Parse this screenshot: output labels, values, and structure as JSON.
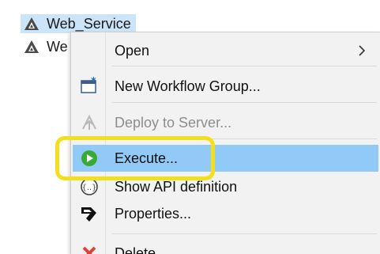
{
  "tree": {
    "items": [
      {
        "label": "Web_Service",
        "selected": true,
        "icon": "service-triangle-icon"
      },
      {
        "label": "We",
        "selected": false,
        "icon": "service-triangle-icon"
      }
    ]
  },
  "context_menu": {
    "items": [
      {
        "id": "open",
        "label": "Open",
        "has_submenu": true,
        "icon": ""
      },
      {
        "id": "new_group",
        "label": "New Workflow Group...",
        "icon": "new-workflow-group-icon"
      },
      {
        "id": "deploy",
        "label": "Deploy to Server...",
        "disabled": true,
        "icon": "deploy-icon"
      },
      {
        "id": "execute",
        "label": "Execute...",
        "highlighted": true,
        "icon": "play-icon"
      },
      {
        "id": "show_api",
        "label": "Show API definition",
        "icon": "api-definition-icon"
      },
      {
        "id": "properties",
        "label": "Properties...",
        "icon": "properties-icon"
      },
      {
        "id": "delete",
        "label": "Delete",
        "icon": "delete-icon"
      }
    ]
  },
  "colors": {
    "menu_bg": "#f2f2f2",
    "hover_bg": "#91c9f7",
    "selection_bg": "#cce4f7",
    "callout": "#f4df1e",
    "play_green": "#3aa935",
    "delete_red": "#d9453b"
  }
}
